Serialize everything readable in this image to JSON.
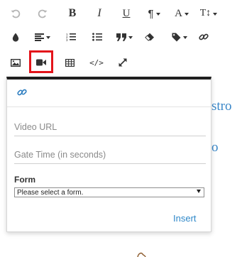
{
  "toolbar": {
    "rows": [
      [
        {
          "name": "undo",
          "icon": "undo-icon",
          "disabled": true
        },
        {
          "name": "redo",
          "icon": "redo-icon",
          "disabled": true
        },
        {
          "name": "bold",
          "label": "B"
        },
        {
          "name": "italic",
          "label": "I"
        },
        {
          "name": "underline",
          "label": "U"
        },
        {
          "name": "paragraph",
          "label": "¶",
          "dropdown": true
        },
        {
          "name": "font-size",
          "label": "A",
          "dropdown": true
        },
        {
          "name": "text-size",
          "label": "T↕",
          "dropdown": true
        }
      ],
      [
        {
          "name": "color",
          "icon": "drop-icon"
        },
        {
          "name": "align",
          "icon": "align-left-icon",
          "dropdown": true
        },
        {
          "name": "ordered-list",
          "icon": "ordered-list-icon"
        },
        {
          "name": "unordered-list",
          "icon": "unordered-list-icon"
        },
        {
          "name": "quote",
          "icon": "quote-icon",
          "dropdown": true
        },
        {
          "name": "clear-format",
          "icon": "eraser-icon"
        },
        {
          "name": "tag",
          "icon": "tag-icon",
          "dropdown": true
        },
        {
          "name": "link",
          "icon": "link-icon"
        }
      ],
      [
        {
          "name": "image",
          "icon": "image-icon"
        },
        {
          "name": "video",
          "icon": "video-camera-icon",
          "highlighted": true
        },
        {
          "name": "table",
          "icon": "table-icon"
        },
        {
          "name": "code",
          "icon": "code-icon",
          "label": "</>"
        },
        {
          "name": "fullscreen",
          "icon": "expand-icon"
        }
      ]
    ],
    "highlight_color": "#e3141b"
  },
  "editor_bg": {
    "text_1": "stro",
    "text_2": "o",
    "text_color": "#3a87c8"
  },
  "video_popover": {
    "link_icon": "link-icon",
    "video_url_placeholder": "Video URL",
    "gate_time_placeholder": "Gate Time (in seconds)",
    "form_label": "Form",
    "form_select_value": "Please select a form.",
    "insert_label": "Insert",
    "accent_color": "#2f88c9"
  }
}
